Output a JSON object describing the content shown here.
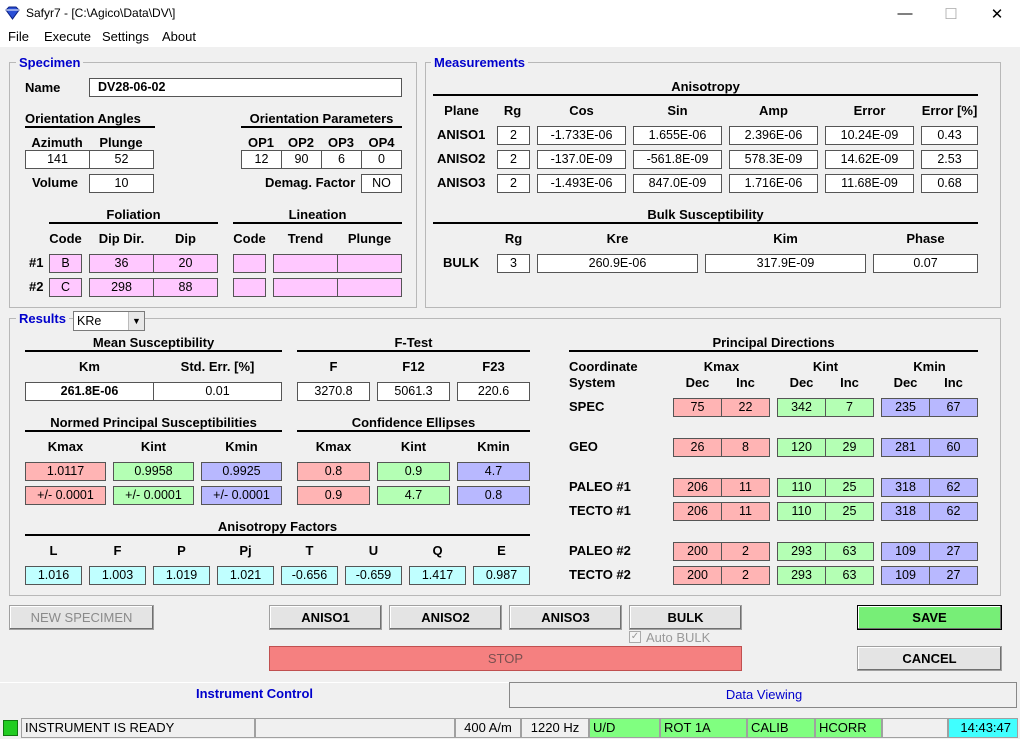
{
  "window": {
    "title": "Safyr7 - [C:\\Agico\\Data\\DV\\]",
    "minimize": "—",
    "maximize": "☐",
    "close": "✕"
  },
  "menu": [
    "File",
    "Execute",
    "Settings",
    "About"
  ],
  "specimen": {
    "group_label": "Specimen",
    "name_label": "Name",
    "name_value": "DV28-06-02",
    "orient_angles_label": "Orientation Angles",
    "azimuth_label": "Azimuth",
    "plunge_label": "Plunge",
    "azimuth": "141",
    "plunge": "52",
    "volume_label": "Volume",
    "volume": "10",
    "orient_params_label": "Orientation Parameters",
    "op_labels": [
      "OP1",
      "OP2",
      "OP3",
      "OP4"
    ],
    "op_values": [
      "12",
      "90",
      "6",
      "0"
    ],
    "demag_label": "Demag. Factor",
    "demag_value": "NO",
    "foliation_label": "Foliation",
    "lineation_label": "Lineation",
    "fol_cols": [
      "Code",
      "Dip Dir.",
      "Dip"
    ],
    "lin_cols": [
      "Code",
      "Trend",
      "Plunge"
    ],
    "row_labels": [
      "#1",
      "#2"
    ],
    "fol_rows": [
      [
        "B",
        "36",
        "20"
      ],
      [
        "C",
        "298",
        "88"
      ]
    ]
  },
  "measurements": {
    "group_label": "Measurements",
    "aniso_title": "Anisotropy",
    "cols": [
      "Plane",
      "Rg",
      "Cos",
      "Sin",
      "Amp",
      "Error",
      "Error [%]"
    ],
    "rows": [
      [
        "ANISO1",
        "2",
        "-1.733E-06",
        "1.655E-06",
        "2.396E-06",
        "10.24E-09",
        "0.43"
      ],
      [
        "ANISO2",
        "2",
        "-137.0E-09",
        "-561.8E-09",
        "578.3E-09",
        "14.62E-09",
        "2.53"
      ],
      [
        "ANISO3",
        "2",
        "-1.493E-06",
        "847.0E-09",
        "1.716E-06",
        "11.68E-09",
        "0.68"
      ]
    ],
    "bulk_title": "Bulk Susceptibility",
    "bulk_cols": [
      "Rg",
      "Kre",
      "Kim",
      "Phase"
    ],
    "bulk_row": [
      "BULK",
      "3",
      "260.9E-06",
      "317.9E-09",
      "0.07"
    ]
  },
  "results": {
    "group_label": "Results",
    "select_value": "KRe",
    "mean_title": "Mean Susceptibility",
    "km_label": "Km",
    "stderr_label": "Std. Err. [%]",
    "km": "261.8E-06",
    "stderr": "0.01",
    "ftest_title": "F-Test",
    "ftest_labels": [
      "F",
      "F12",
      "F23"
    ],
    "ftest_values": [
      "3270.8",
      "5061.3",
      "220.6"
    ],
    "normed_title": "Normed Principal Susceptibilities",
    "k_labels": [
      "Kmax",
      "Kint",
      "Kmin"
    ],
    "normed_values": [
      "1.0117",
      "0.9958",
      "0.9925"
    ],
    "normed_errors": [
      "+/-  0.0001",
      "+/-  0.0001",
      "+/-  0.0001"
    ],
    "conf_title": "Confidence Ellipses",
    "conf_row1": [
      "0.8",
      "0.9",
      "4.7"
    ],
    "conf_row2": [
      "0.9",
      "4.7",
      "0.8"
    ],
    "af_title": "Anisotropy Factors",
    "af_labels": [
      "L",
      "F",
      "P",
      "Pj",
      "T",
      "U",
      "Q",
      "E"
    ],
    "af_values": [
      "1.016",
      "1.003",
      "1.019",
      "1.021",
      "-0.656",
      "-0.659",
      "1.417",
      "0.987"
    ],
    "pd_title": "Principal Directions",
    "coord_label": "Coordinate",
    "system_label": "System",
    "dec_label": "Dec",
    "inc_label": "Inc",
    "pd_rows": [
      {
        "name": "SPEC",
        "vals": [
          "75",
          "22",
          "342",
          "7",
          "235",
          "67"
        ]
      },
      {
        "name": "GEO",
        "vals": [
          "26",
          "8",
          "120",
          "29",
          "281",
          "60"
        ]
      },
      {
        "name": "PALEO #1",
        "vals": [
          "206",
          "11",
          "110",
          "25",
          "318",
          "62"
        ]
      },
      {
        "name": "TECTO #1",
        "vals": [
          "206",
          "11",
          "110",
          "25",
          "318",
          "62"
        ]
      },
      {
        "name": "PALEO #2",
        "vals": [
          "200",
          "2",
          "293",
          "63",
          "109",
          "27"
        ]
      },
      {
        "name": "TECTO #2",
        "vals": [
          "200",
          "2",
          "293",
          "63",
          "109",
          "27"
        ]
      }
    ]
  },
  "buttons": {
    "new_specimen": "NEW SPECIMEN",
    "aniso1": "ANISO1",
    "aniso2": "ANISO2",
    "aniso3": "ANISO3",
    "bulk": "BULK",
    "auto_bulk": "Auto BULK",
    "save": "SAVE",
    "stop": "STOP",
    "cancel": "CANCEL"
  },
  "tabs": [
    "Instrument Control",
    "Data Viewing"
  ],
  "statusbar": {
    "message": "INSTRUMENT IS READY",
    "field": "400 A/m",
    "freq": "1220 Hz",
    "ud": "U/D",
    "rot": "ROT 1A",
    "calib": "CALIB",
    "hcorr": "HCORR",
    "time": "14:43:47"
  }
}
